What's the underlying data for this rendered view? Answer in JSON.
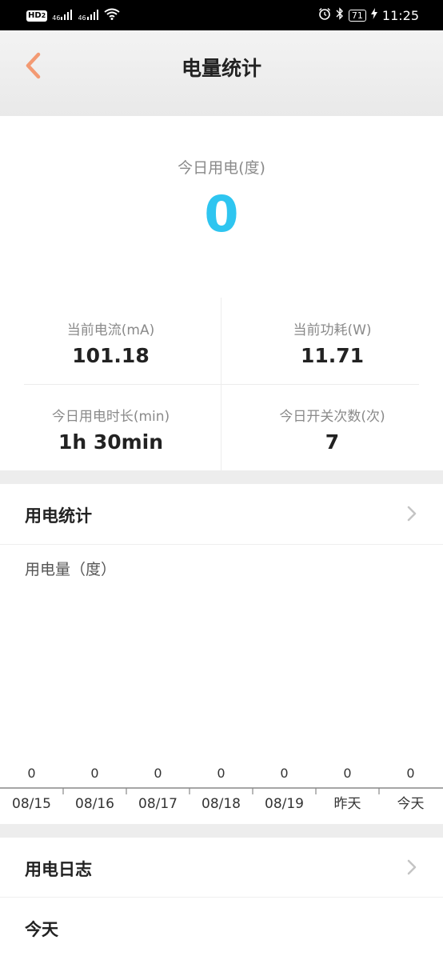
{
  "status_bar": {
    "hd": "HD",
    "hd_sub": "2",
    "net1": "46",
    "net2": "46",
    "battery": "71",
    "time": "11:25"
  },
  "header": {
    "title": "电量统计"
  },
  "today": {
    "label": "今日用电(度)",
    "value": "0"
  },
  "stats": [
    {
      "label": "当前电流(mA)",
      "value": "101.18"
    },
    {
      "label": "当前功耗(W)",
      "value": "11.71"
    },
    {
      "label": "今日用电时长(min)",
      "value": "1h 30min"
    },
    {
      "label": "今日开关次数(次)",
      "value": "7"
    }
  ],
  "usage_section": {
    "title": "用电统计",
    "chart_label": "用电量（度）"
  },
  "chart_data": {
    "type": "bar",
    "categories": [
      "08/15",
      "08/16",
      "08/17",
      "08/18",
      "08/19",
      "昨天",
      "今天"
    ],
    "values": [
      0,
      0,
      0,
      0,
      0,
      0,
      0
    ],
    "title": "",
    "xlabel": "",
    "ylabel": "用电量（度）"
  },
  "log_section": {
    "title": "用电日志",
    "today": "今天"
  },
  "colors": {
    "accent": "#2ec5f0",
    "back_arrow": "#f39a73"
  }
}
